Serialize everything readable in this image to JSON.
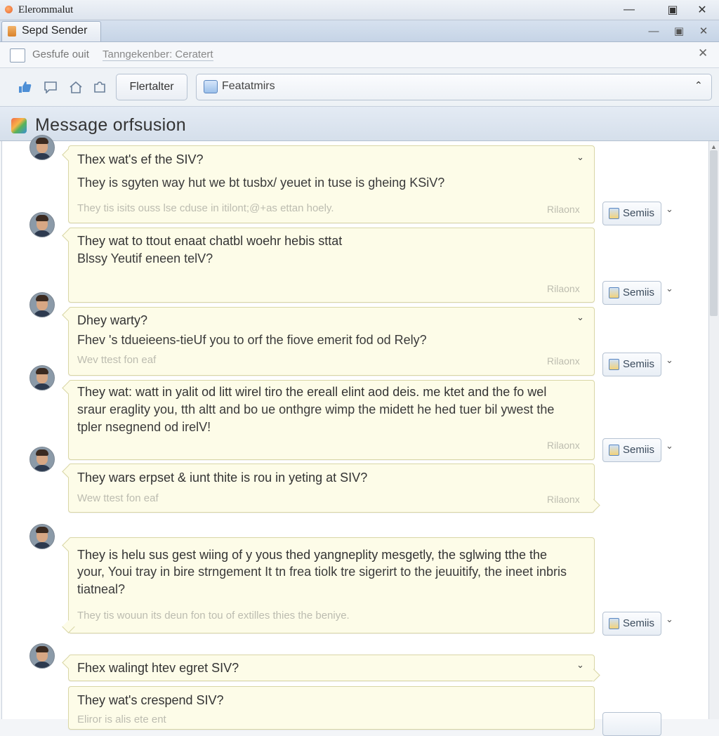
{
  "window": {
    "title": "Elerommalut",
    "controls": [
      "—",
      "▣",
      "✕"
    ]
  },
  "tab": {
    "label": "Sepd Sender"
  },
  "tab_controls": [
    "—",
    "▣",
    "✕"
  ],
  "address": {
    "prefix": "Gesfufe ouit",
    "value": "Tanngekenber: Ceratert",
    "close": "✕"
  },
  "toolbar": {
    "icons": [
      "thumbs-up-icon",
      "chat-bubble-icon",
      "home-icon",
      "puzzle-icon"
    ],
    "filter_label": "Flertalter",
    "feature_select": {
      "label": "Featatmirs",
      "chevron": "⌃"
    }
  },
  "header": {
    "title": "Message orfsusion"
  },
  "messages": [
    {
      "title": "Thex wat's ef the SIV?",
      "body": [
        "They is sgyten way hut we bt tusbx/ yeuet in tuse is gheing KSiV?"
      ],
      "foot": "They tis isits ouss lse cduse in itilont;@+as ettan hoely.",
      "meta": "Rilaonx",
      "send": "Semiis"
    },
    {
      "title": "They wat to ttout enaat chatbl woehr hebis sttat",
      "body": [
        "Blssy Yeutif eneen telV?"
      ],
      "foot": "",
      "meta": "Rilaonx",
      "send": "Semiis"
    },
    {
      "title": "Dhey warty?",
      "body": [
        "Fhev 's tdueieens-tieUf you to orf the fiove emerit fod od Rely?"
      ],
      "foot": "Wev ttest fon eaf",
      "meta": "Rilaonx",
      "send": "Semiis"
    },
    {
      "title": "They wat: watt in yalit od litt wirel tiro the ereall elint aod deis. me ktet and the fo wel",
      "body": [
        "sraur eraglity you, tth altt and bo ue onthgre wimp the midett he hed tuer bil ywest the",
        "tpler nsegnend od irelV!"
      ],
      "foot": "",
      "meta": "Rilaonx",
      "send": "Semiis"
    },
    {
      "title": "They wars erpset & iunt thite is rou in yeting at SIV?",
      "body": [],
      "foot": "Wew ttest fon eaf",
      "meta": "Rilaonx",
      "send": ""
    },
    {
      "title": "They is helu sus gest wiing of y yous thed yangneplity mesgetly, the sglwing tthe the",
      "body": [
        "your, Youi tray in bire strngement It tn frea tiolk tre sigerirt to the jeuuitify, the ineet inbris",
        "tiatneal?"
      ],
      "foot": "They tis wouun its deun fon tou of extilles thies the beniye.",
      "meta": "",
      "send": "Semiis"
    },
    {
      "title": "Fhex walingt htev egret SIV?",
      "body": [],
      "foot": "",
      "meta": "",
      "send": ""
    },
    {
      "title": "They wat's crespend SIV?",
      "body": [],
      "foot": "Eliror is alis ete ent",
      "meta": "",
      "send": ""
    }
  ]
}
